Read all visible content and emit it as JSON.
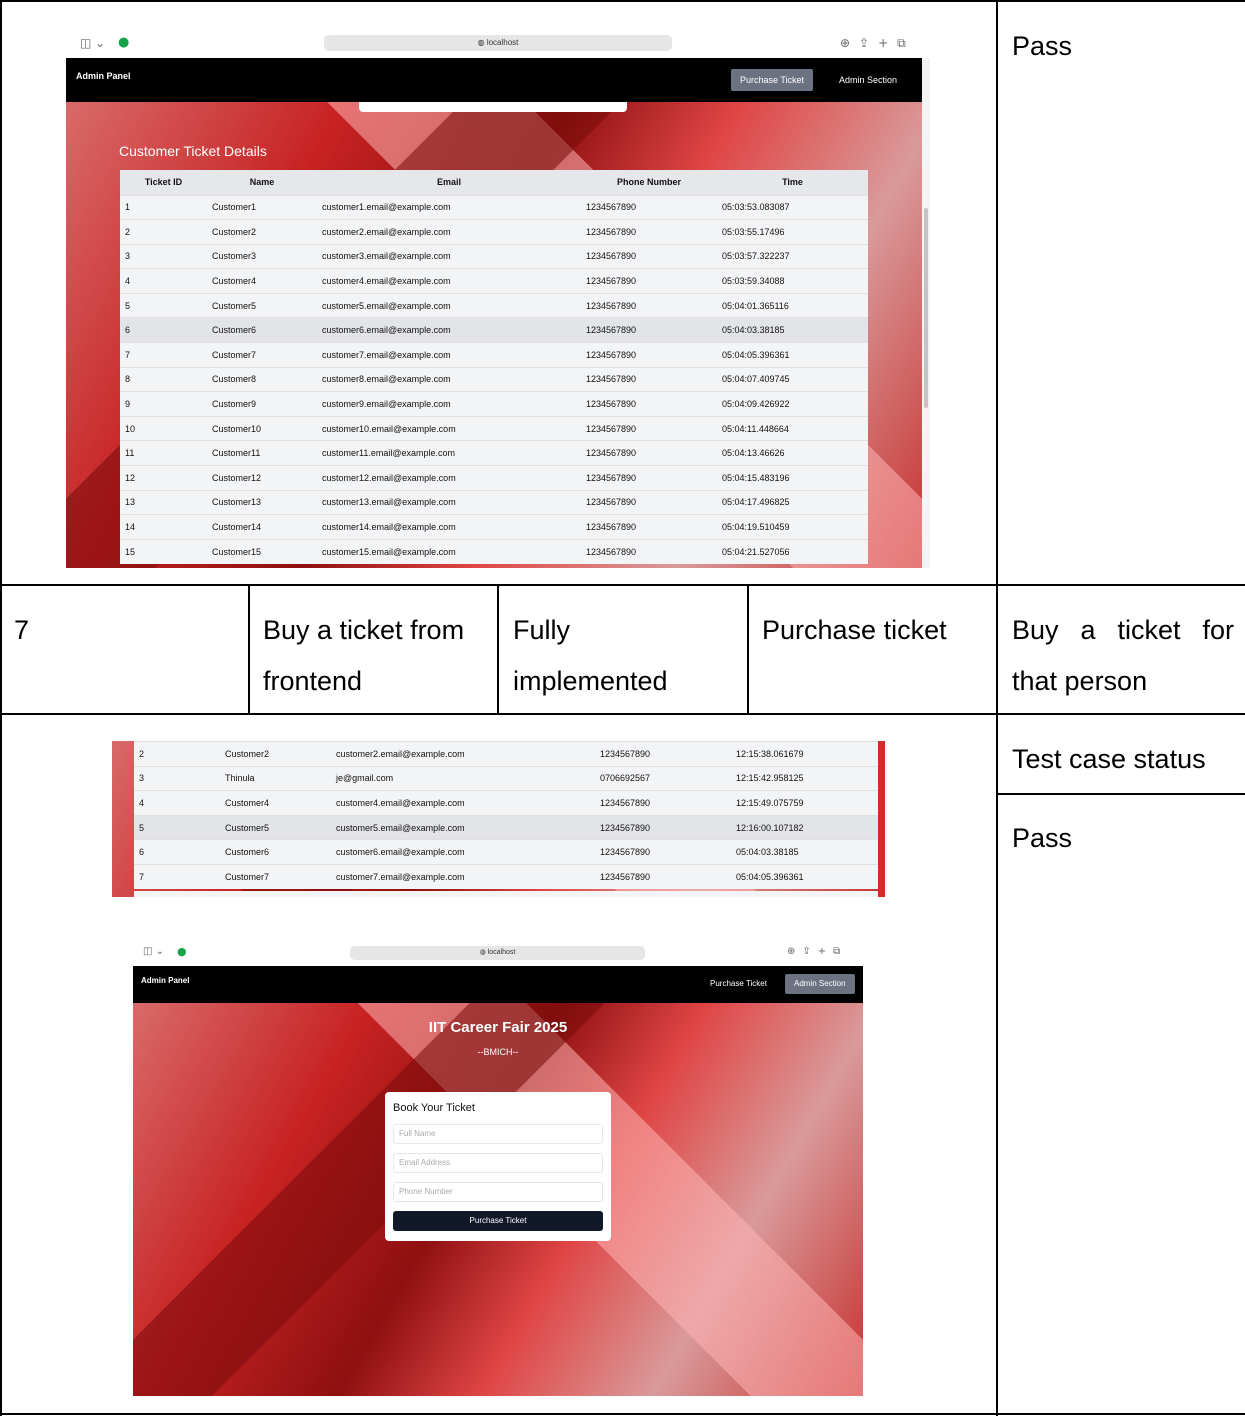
{
  "top_result": "Pass",
  "row": {
    "id": "7",
    "description_line1": "Buy a ticket from",
    "description_line2": "frontend",
    "implementation_line1": "Fully",
    "implementation_line2": "implemented",
    "action": "Purchase ticket",
    "expected_line1": "Buy a ticket for",
    "expected_line2": "that person"
  },
  "status_label": "Test case status",
  "status_value": "Pass",
  "browser": {
    "url": "localhost",
    "brand": "Admin Panel",
    "purchase_btn": "Purchase Ticket",
    "admin_btn": "Admin Section"
  },
  "ticket_table": {
    "title": "Customer Ticket Details",
    "columns": [
      "Ticket ID",
      "Name",
      "Email",
      "Phone Number",
      "Time"
    ],
    "rows": [
      [
        "1",
        "Customer1",
        "customer1.email@example.com",
        "1234567890",
        "05:03:53.083087"
      ],
      [
        "2",
        "Customer2",
        "customer2.email@example.com",
        "1234567890",
        "05:03:55.17496"
      ],
      [
        "3",
        "Customer3",
        "customer3.email@example.com",
        "1234567890",
        "05:03:57.322237"
      ],
      [
        "4",
        "Customer4",
        "customer4.email@example.com",
        "1234567890",
        "05:03:59.34088"
      ],
      [
        "5",
        "Customer5",
        "customer5.email@example.com",
        "1234567890",
        "05:04:01.365116"
      ],
      [
        "6",
        "Customer6",
        "customer6.email@example.com",
        "1234567890",
        "05:04:03.38185"
      ],
      [
        "7",
        "Customer7",
        "customer7.email@example.com",
        "1234567890",
        "05:04:05.396361"
      ],
      [
        "8",
        "Customer8",
        "customer8.email@example.com",
        "1234567890",
        "05:04:07.409745"
      ],
      [
        "9",
        "Customer9",
        "customer9.email@example.com",
        "1234567890",
        "05:04:09.426922"
      ],
      [
        "10",
        "Customer10",
        "customer10.email@example.com",
        "1234567890",
        "05:04:11.448664"
      ],
      [
        "11",
        "Customer11",
        "customer11.email@example.com",
        "1234567890",
        "05:04:13.46626"
      ],
      [
        "12",
        "Customer12",
        "customer12.email@example.com",
        "1234567890",
        "05:04:15.483196"
      ],
      [
        "13",
        "Customer13",
        "customer13.email@example.com",
        "1234567890",
        "05:04:17.496825"
      ],
      [
        "14",
        "Customer14",
        "customer14.email@example.com",
        "1234567890",
        "05:04:19.510459"
      ],
      [
        "15",
        "Customer15",
        "customer15.email@example.com",
        "1234567890",
        "05:04:21.527056"
      ]
    ]
  },
  "partial_table": {
    "rows": [
      [
        "2",
        "Customer2",
        "customer2.email@example.com",
        "1234567890",
        "12:15:38.061679"
      ],
      [
        "3",
        "Thinula",
        "je@gmail.com",
        "0706692567",
        "12:15:42.958125"
      ],
      [
        "4",
        "Customer4",
        "customer4.email@example.com",
        "1234567890",
        "12:15:49.075759"
      ],
      [
        "5",
        "Customer5",
        "customer5.email@example.com",
        "1234567890",
        "12:16:00.107182"
      ],
      [
        "6",
        "Customer6",
        "customer6.email@example.com",
        "1234567890",
        "05:04:03.38185"
      ],
      [
        "7",
        "Customer7",
        "customer7.email@example.com",
        "1234567890",
        "05:04:05.396361"
      ]
    ]
  },
  "booking": {
    "event_title": "IIT Career Fair 2025",
    "venue": "--BMICH--",
    "form_title": "Book Your Ticket",
    "name_placeholder": "Full Name",
    "email_placeholder": "Email Address",
    "phone_placeholder": "Phone Number",
    "submit_label": "Purchase Ticket"
  }
}
